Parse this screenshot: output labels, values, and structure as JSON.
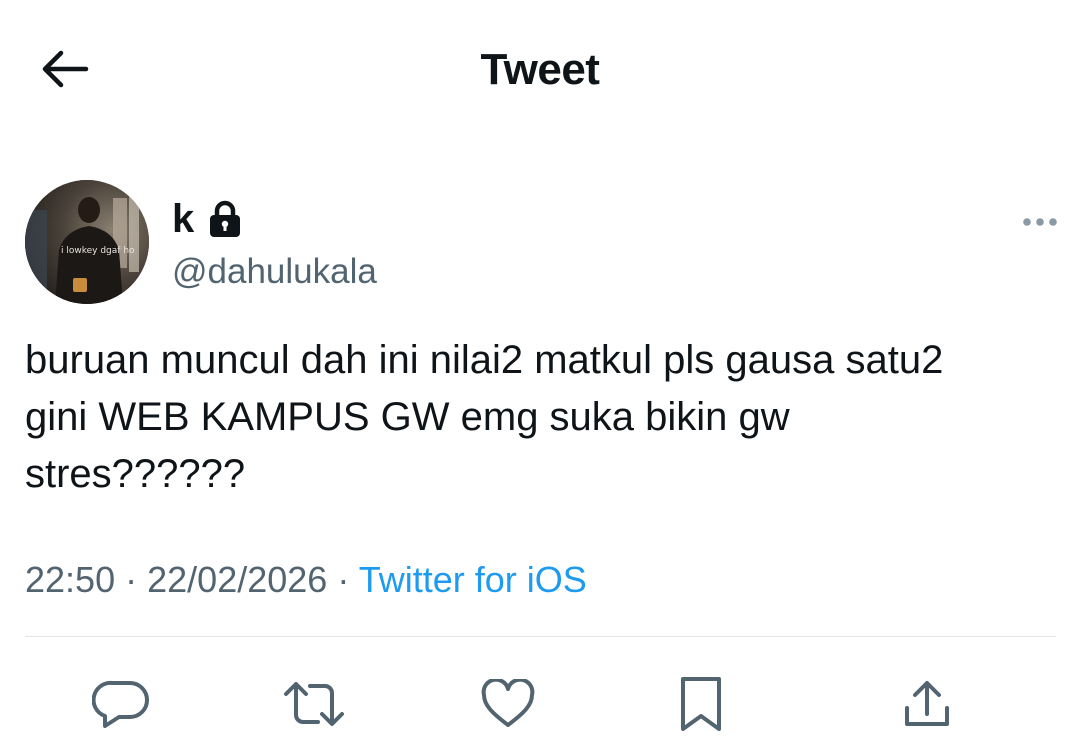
{
  "header": {
    "title": "Tweet",
    "back_icon": "arrow-left-icon"
  },
  "author": {
    "display_name": "k",
    "handle": "@dahulukala",
    "protected_icon": "lock-icon",
    "avatar_caption": "i lowkey dgaf ho"
  },
  "tweet": {
    "text": "buruan muncul dah ini nilai2 matkul pls gausa satu2\ngini WEB KAMPUS GW emg suka bikin gw\nstres??????",
    "time": "22:50",
    "date": "22/02/2026",
    "separator": "·",
    "source": "Twitter for iOS"
  },
  "actions": {
    "reply_icon": "reply-icon",
    "retweet_icon": "retweet-icon",
    "like_icon": "heart-icon",
    "bookmark_icon": "bookmark-icon",
    "share_icon": "share-icon"
  },
  "colors": {
    "text": "#0f1419",
    "secondary": "#536471",
    "accent": "#1d9bf0",
    "divider": "#e1e6ea"
  }
}
